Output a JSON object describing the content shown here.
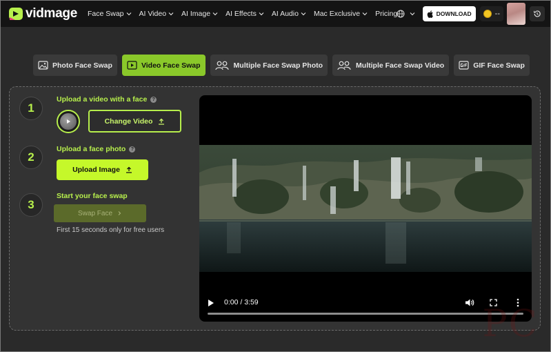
{
  "app": {
    "logo_text": "vidmage",
    "nav": [
      {
        "label": "Face Swap",
        "dropdown": true
      },
      {
        "label": "AI Video",
        "dropdown": true
      },
      {
        "label": "AI Image",
        "dropdown": true
      },
      {
        "label": "AI Effects",
        "dropdown": true
      },
      {
        "label": "AI Audio",
        "dropdown": true
      },
      {
        "label": "Mac Exclusive",
        "dropdown": true
      },
      {
        "label": "Pricing",
        "dropdown": false
      }
    ],
    "download_label": "DOWNLOAD",
    "credits": "--"
  },
  "tabs": [
    {
      "label": "Photo Face Swap",
      "icon": "image-icon",
      "active": false
    },
    {
      "label": "Video Face Swap",
      "icon": "video-icon",
      "active": true
    },
    {
      "label": "Multiple Face Swap Photo",
      "icon": "users-icon",
      "active": false
    },
    {
      "label": "Multiple Face Swap Video",
      "icon": "users-icon",
      "active": false
    },
    {
      "label": "GIF Face Swap",
      "icon": "gif-icon",
      "active": false
    }
  ],
  "steps": {
    "step1": {
      "number": "1",
      "title": "Upload a video with a face",
      "button": "Change Video"
    },
    "step2": {
      "number": "2",
      "title": "Upload a face photo",
      "button": "Upload Image"
    },
    "step3": {
      "number": "3",
      "title": "Start your face swap",
      "button": "Swap Face",
      "note": "First 15 seconds only for free users"
    }
  },
  "player": {
    "time": "0:00 / 3:59",
    "progress": 0
  },
  "colors": {
    "accent": "#b7ef4c",
    "accent_button": "#c5f82a",
    "nav_bg": "#141414",
    "panel_bg": "#333333"
  }
}
